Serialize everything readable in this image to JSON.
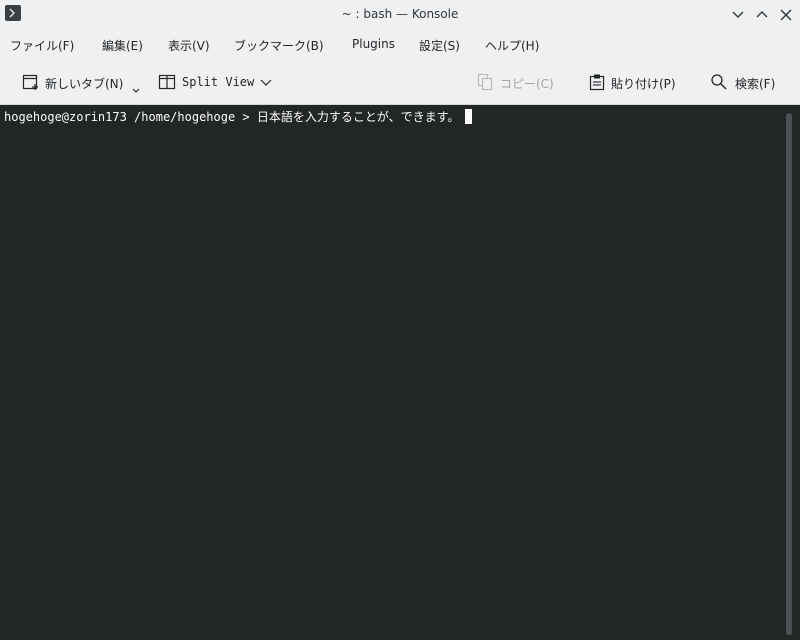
{
  "window": {
    "title": "~ : bash — Konsole"
  },
  "menubar": {
    "items": [
      {
        "label": "ファイル(F)"
      },
      {
        "label": "編集(E)"
      },
      {
        "label": "表示(V)"
      },
      {
        "label": "ブックマーク(B)"
      },
      {
        "label": "Plugins"
      },
      {
        "label": "設定(S)"
      },
      {
        "label": "ヘルプ(H)"
      }
    ]
  },
  "toolbar": {
    "new_tab_label": "新しいタブ(N)",
    "split_view_label": "Split View",
    "copy_label": "コピー(C)",
    "paste_label": "貼り付け(P)",
    "find_label": "検索(F)"
  },
  "terminal": {
    "prompt": "hogehoge@zorin173 /home/hogehoge > ",
    "input": "日本語を入力することが、できます。"
  },
  "colors": {
    "terminal_bg": "#232627",
    "terminal_fg": "#fcfcfc",
    "chrome_bg": "#eff0f1"
  }
}
